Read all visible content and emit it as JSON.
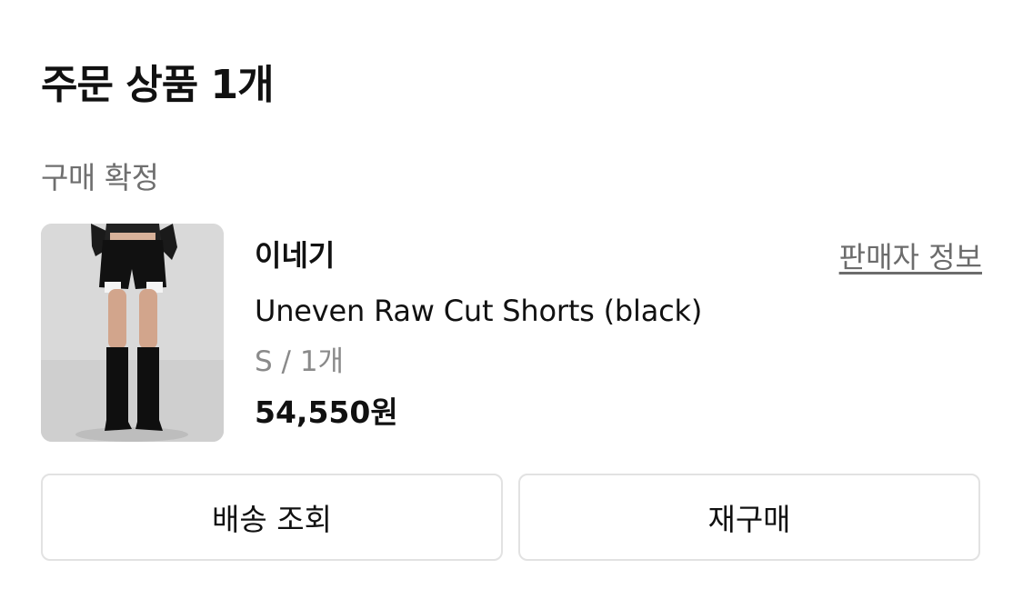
{
  "header": {
    "title": "주문 상품 1개"
  },
  "order": {
    "status": "구매 확정",
    "seller": "이네기",
    "seller_info_link": "판매자 정보",
    "product_name": "Uneven Raw Cut Shorts (black)",
    "option": "S / 1개",
    "price": "54,550원",
    "image_icon": "product-photo"
  },
  "actions": {
    "track_delivery": "배송 조회",
    "repurchase": "재구매"
  },
  "colors": {
    "text_primary": "#111111",
    "text_secondary": "#6f6f6f",
    "text_muted": "#8a8a8a",
    "border": "#e2e2e2"
  }
}
